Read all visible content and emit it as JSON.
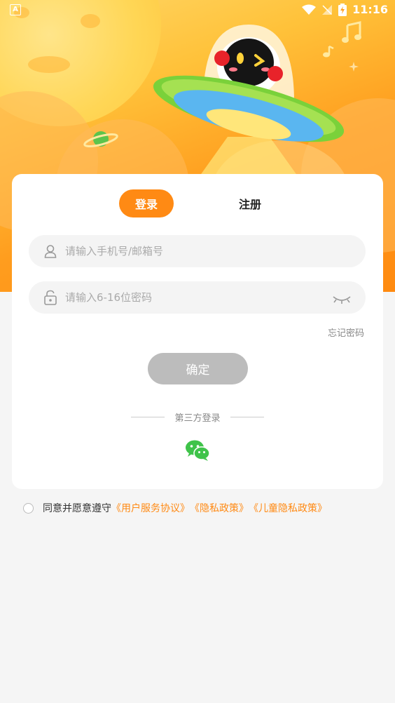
{
  "status_bar": {
    "time": "11:16",
    "app_badge": "A"
  },
  "tabs": {
    "login": "登录",
    "register": "注册"
  },
  "fields": {
    "account_placeholder": "请输入手机号/邮箱号",
    "password_placeholder": "请输入6-16位密码",
    "account_value": "",
    "password_value": ""
  },
  "forgot_password": "忘记密码",
  "confirm_button": "确定",
  "third_party": {
    "label": "第三方登录",
    "providers": [
      "wechat"
    ]
  },
  "agreement": {
    "checked": false,
    "prefix": "同意并愿意遵守",
    "link_user": "《用户服务协议》",
    "link_privacy": "《隐私政策》",
    "link_child": "《儿童隐私政策》"
  },
  "colors": {
    "accent": "#ff8a14",
    "confirm_disabled": "#bcbcbc",
    "wechat": "#3fc34a",
    "hero_top": "#ffd86a",
    "hero_bottom": "#ff8a10"
  },
  "icons": [
    "user-icon",
    "lock-icon",
    "eye-closed-icon",
    "wechat-icon",
    "wifi-icon",
    "signal-icon",
    "battery-icon",
    "ufo-mascot-illustration",
    "moon-illustration",
    "planet-icon",
    "music-note-icon"
  ]
}
